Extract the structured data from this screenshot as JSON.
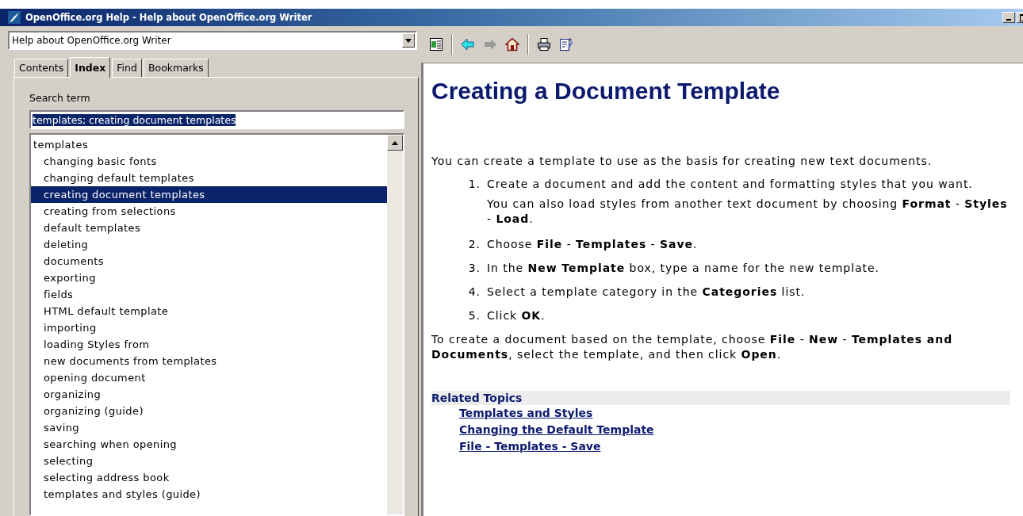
{
  "window": {
    "title": "OpenOffice.org Help - Help about OpenOffice.org Writer"
  },
  "module_select": {
    "value": "Help about OpenOffice.org Writer"
  },
  "tabs": [
    {
      "label": "Contents",
      "selected": false
    },
    {
      "label": "Index",
      "selected": true
    },
    {
      "label": "Find",
      "selected": false
    },
    {
      "label": "Bookmarks",
      "selected": false
    }
  ],
  "search": {
    "label": "Search term",
    "value": "templates; creating document templates"
  },
  "index": [
    {
      "label": "templates",
      "selected": false,
      "children": [
        {
          "label": "changing basic fonts",
          "selected": false
        },
        {
          "label": "changing default templates",
          "selected": false
        },
        {
          "label": "creating document templates",
          "selected": true
        },
        {
          "label": "creating from selections",
          "selected": false
        },
        {
          "label": "default templates",
          "selected": false
        },
        {
          "label": "deleting",
          "selected": false
        },
        {
          "label": "documents",
          "selected": false
        },
        {
          "label": "exporting",
          "selected": false
        },
        {
          "label": "fields",
          "selected": false
        },
        {
          "label": "HTML default template",
          "selected": false
        },
        {
          "label": "importing",
          "selected": false
        },
        {
          "label": "loading Styles from",
          "selected": false
        },
        {
          "label": "new documents from templates",
          "selected": false
        },
        {
          "label": "opening document",
          "selected": false
        },
        {
          "label": "organizing",
          "selected": false
        },
        {
          "label": "organizing (guide)",
          "selected": false
        },
        {
          "label": "saving",
          "selected": false
        },
        {
          "label": "searching when opening",
          "selected": false
        },
        {
          "label": "selecting",
          "selected": false
        },
        {
          "label": "selecting address book",
          "selected": false
        },
        {
          "label": "templates and styles (guide)",
          "selected": false
        }
      ]
    }
  ],
  "toolbar": [
    {
      "kind": "index-toggle"
    },
    {
      "kind": "separator"
    },
    {
      "kind": "back",
      "disabled": false
    },
    {
      "kind": "forward",
      "disabled": true
    },
    {
      "kind": "home"
    },
    {
      "kind": "separator"
    },
    {
      "kind": "print"
    },
    {
      "kind": "bookmark"
    }
  ],
  "content": {
    "heading": "Creating a Document Template",
    "intro": "You can create a template to use as the basis for creating new text documents.",
    "steps": [
      {
        "number": "1.",
        "text": "Create a document and add the content and formatting styles that you want.",
        "note": "You can also load styles from another text document by choosing **Format** - **Styles** - **Load**."
      },
      {
        "number": "2.",
        "text": "Choose **File** - **Templates** - **Save**."
      },
      {
        "number": "3.",
        "text": "In the **New Template** box, type a name for the new template."
      },
      {
        "number": "4.",
        "text": "Select a template category in the **Categories** list."
      },
      {
        "number": "5.",
        "text": "Click **OK**."
      }
    ],
    "outro": "To create a document based on the template, choose **File** - **New** - **Templates and Documents**, select the template, and then click **Open**.",
    "related_heading": "Related Topics",
    "related_links": [
      "Templates and Styles",
      "Changing the Default Template",
      "File - Templates - Save"
    ]
  }
}
